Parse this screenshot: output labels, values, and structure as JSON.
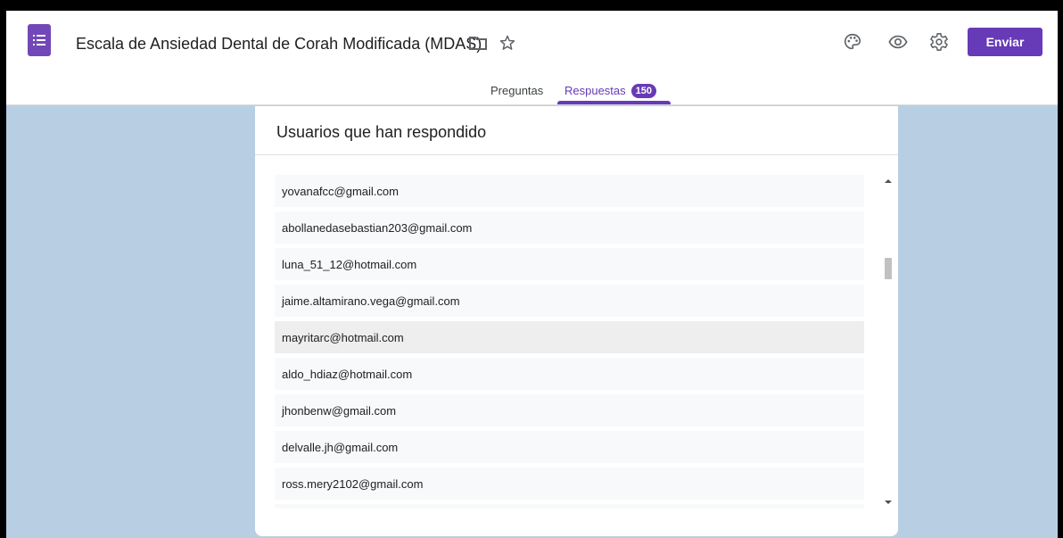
{
  "header": {
    "title": "Escala de Ansiedad Dental de Corah Modificada (MDAS)",
    "send_label": "Enviar",
    "icons": [
      "forms-logo-icon",
      "folder-icon",
      "star-icon",
      "palette-icon",
      "preview-eye-icon",
      "settings-gear-icon"
    ],
    "accent_color": "#673ab7"
  },
  "tabs": [
    {
      "label": "Preguntas",
      "active": false
    },
    {
      "label": "Respuestas",
      "active": true,
      "count": "150"
    }
  ],
  "card": {
    "title": "Usuarios que han respondido"
  },
  "respondents": [
    "yovanafcc@gmail.com",
    "abollanedasebastian203@gmail.com",
    "luna_51_12@hotmail.com",
    "jaime.altamirano.vega@gmail.com",
    "mayritarc@hotmail.com",
    "aldo_hdiaz@hotmail.com",
    "jhonbenw@gmail.com",
    "delvalle.jh@gmail.com",
    "ross.mery2102@gmail.com",
    ""
  ]
}
